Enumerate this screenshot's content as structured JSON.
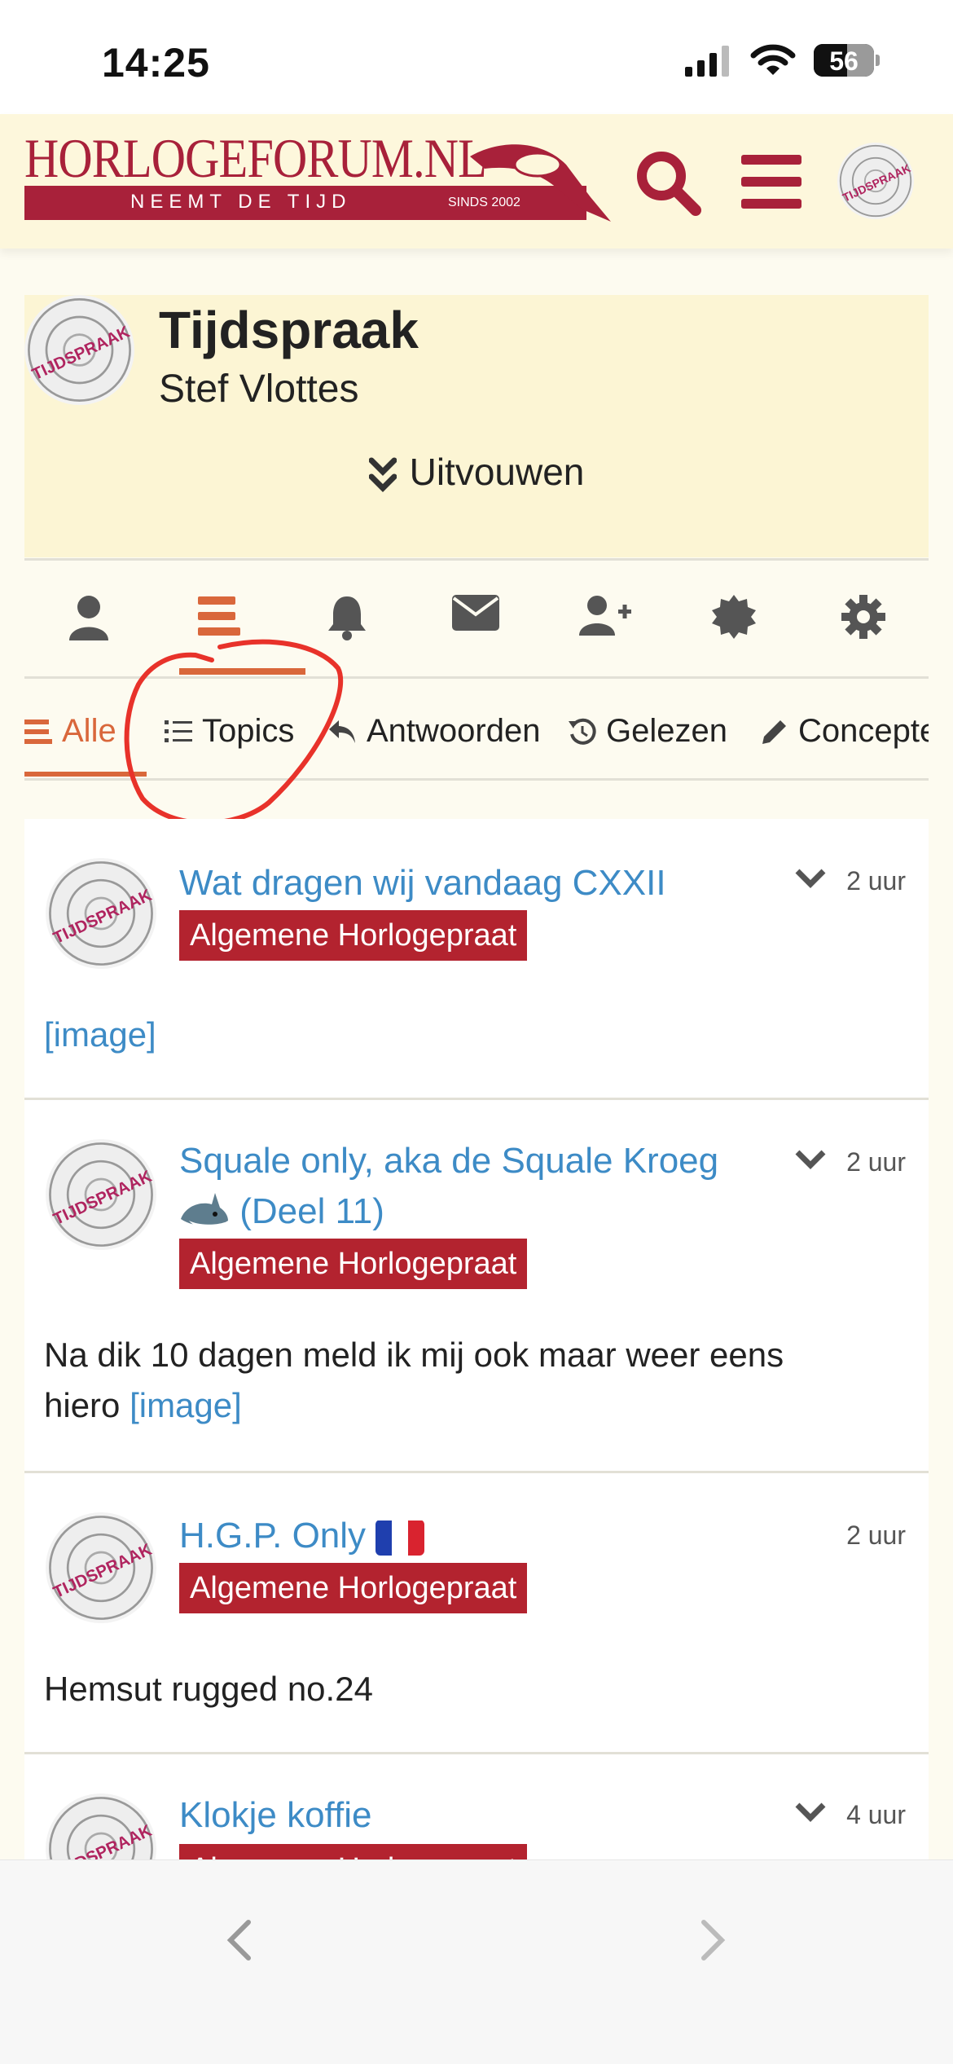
{
  "status_bar": {
    "time": "14:25",
    "battery": "56",
    "battery_level": 0.56
  },
  "header": {
    "logo_text": "HORLOGEFORUM.NL",
    "logo_tagline": "NEEMT DE TIJD",
    "logo_since": "SINDS 2002",
    "search_icon": "search-icon",
    "menu_icon": "hamburger-menu-icon",
    "avatar_text": "TIJDSPRAAK"
  },
  "profile": {
    "name": "Tijdspraak",
    "fullname": "Stef Vlottes",
    "expand_label": "Uitvouwen",
    "avatar_text": "TIJDSPRAAK"
  },
  "nav_icons": [
    "user-icon",
    "activity-list-icon",
    "bell-icon",
    "envelope-icon",
    "user-plus-icon",
    "badge-icon",
    "gear-icon"
  ],
  "tabs": [
    {
      "label": "Alle",
      "icon": "stream-icon",
      "active": true
    },
    {
      "label": "Topics",
      "icon": "list-icon"
    },
    {
      "label": "Antwoorden",
      "icon": "reply-icon"
    },
    {
      "label": "Gelezen",
      "icon": "history-icon"
    },
    {
      "label": "Concepten",
      "icon": "pencil-icon"
    }
  ],
  "posts": [
    {
      "title": "Wat dragen wij vandaag CXXII",
      "category": "Algemene Horlogepraat",
      "time": "2 uur",
      "body_link": "[image]"
    },
    {
      "title_line1": "Squale only, aka de Squale Kroeg",
      "title_line2": "(Deel 11)",
      "category": "Algemene Horlogepraat",
      "time": "2 uur",
      "body_text_1": "Na dik 10 dagen meld ik mij ook maar weer eens",
      "body_text_2": "hiero ",
      "body_link": "[image]"
    },
    {
      "title": "H.G.P. Only",
      "category": "Algemene Horlogepraat",
      "time": "2 uur",
      "body_text": "Hemsut rugged no.24"
    },
    {
      "title": "Klokje koffie",
      "category": "Algemene Horlogepraat",
      "time": "4 uur"
    }
  ],
  "colors": {
    "brand": "#a8213a",
    "accent": "#d9673b",
    "link": "#3d8bc6",
    "category": "#b3232f",
    "annotation": "#e8322a"
  }
}
